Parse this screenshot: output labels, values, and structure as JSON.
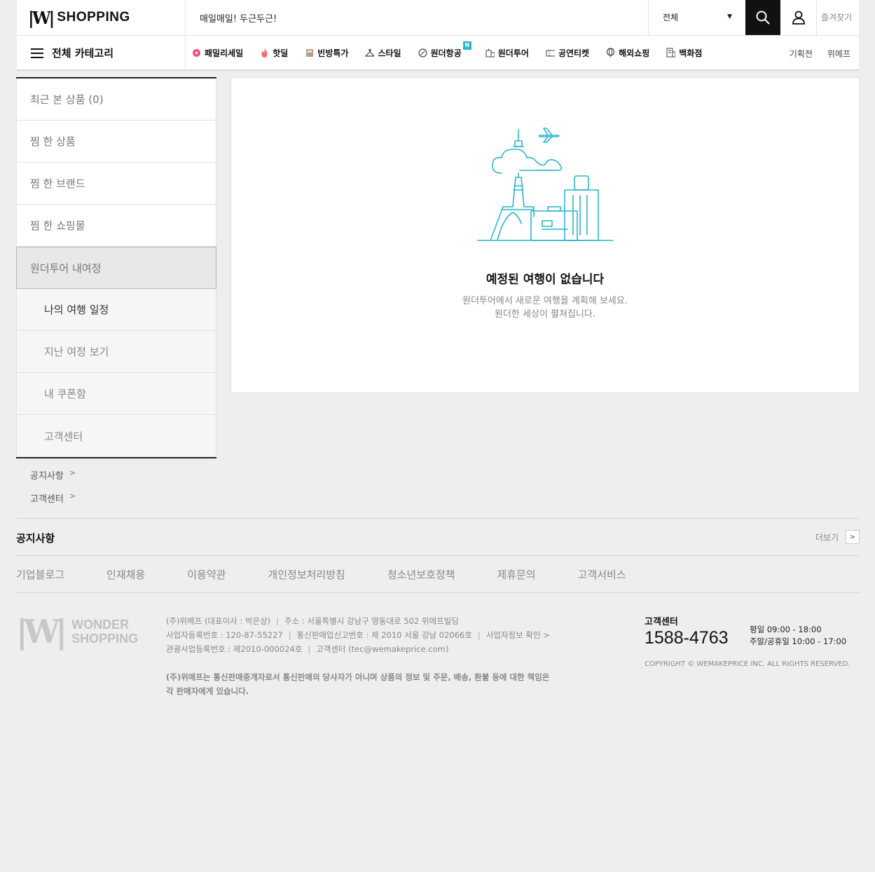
{
  "header": {
    "logo_text": "SHOPPING",
    "search_placeholder": "매일매일! 두근두근!",
    "category_select": "전체",
    "favorites": "즐겨찾기",
    "all_categories": "전체 카테고리",
    "nav": [
      {
        "label": "패밀리세일",
        "icon": "flower-icon"
      },
      {
        "label": "핫딜",
        "icon": "fire-icon"
      },
      {
        "label": "빈방특가",
        "icon": "bed-icon"
      },
      {
        "label": "스타일",
        "icon": "hanger-icon"
      },
      {
        "label": "원더항공",
        "icon": "plane-icon",
        "badge": "N"
      },
      {
        "label": "원더투어",
        "icon": "tour-icon"
      },
      {
        "label": "공연티켓",
        "icon": "ticket-icon"
      },
      {
        "label": "해외쇼핑",
        "icon": "globe-icon"
      },
      {
        "label": "백화점",
        "icon": "building-icon"
      }
    ],
    "right_links": [
      "기획전",
      "위메프"
    ]
  },
  "sidebar": {
    "items": [
      {
        "label": "최근 본 상품 (0)"
      },
      {
        "label": "찜 한 상품"
      },
      {
        "label": "찜 한 브랜드"
      },
      {
        "label": "찜 한 쇼핑몰"
      },
      {
        "label": "원더투어 내여정"
      },
      {
        "label": "나의 여행 일정"
      },
      {
        "label": "지난 여정 보기"
      },
      {
        "label": "내 쿠폰함"
      },
      {
        "label": "고객센터"
      }
    ],
    "links": [
      "공지사항",
      "고객센터"
    ]
  },
  "main": {
    "empty_title": "예정된 여행이 없습니다",
    "empty_desc_line1": "원더투어에서 새로운 여행을 계획해 보세요.",
    "empty_desc_line2": "원더한 세상이 펼쳐집니다."
  },
  "footer": {
    "notice_title": "공지사항",
    "more": "더보기",
    "links": [
      "기업블로그",
      "인재채용",
      "이용약관",
      "개인정보처리방침",
      "청소년보호정책",
      "제휴문의",
      "고객서비스"
    ],
    "logo_line1": "WONDER",
    "logo_line2": "SHOPPING",
    "info": {
      "company": "(주)위메프 (대표이사 : 박은상)",
      "address": "주소 : 서울특별시 강남구 영동대로 502 위메프빌딩",
      "biz_no": "사업자등록번호 : 120-87-55227",
      "mail_order": "통신판매업신고번호 : 제 2010 서울 강남 02066호",
      "biz_check": "사업자정보 확인 >",
      "tour_reg": "관광사업등록번호 : 제2010-000024호",
      "cs_email": "고객센터 (tec@wemakeprice.com)"
    },
    "disclaimer": "(주)위메프는 통신판매중개자로서 통신판매의 당사자가 아니며 상품의 정보 및 주문, 배송, 환불 등에 대한 책임은 각 판매자에게 있습니다.",
    "cs_title": "고객센터",
    "cs_phone": "1588-4763",
    "hours_weekday": "평일 09:00 - 18:00",
    "hours_weekend": "주말/공휴일 10:00 - 17:00",
    "copyright": "COPYRIGHT © WEMAKEPRICE INC. ALL RIGHTS RESERVED."
  },
  "colors": {
    "accent": "#29b6c9",
    "dark": "#111111",
    "bg": "#eeeeee"
  }
}
